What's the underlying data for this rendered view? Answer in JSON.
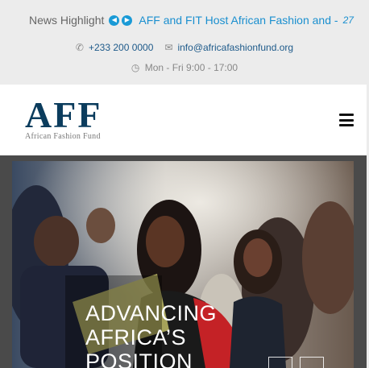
{
  "news": {
    "label": "News Highlight",
    "prev_icon": "chevron-left-circle-icon",
    "next_icon": "chevron-right-circle-icon",
    "headline": "AFF and FIT Host African Fashion and -",
    "date": "27"
  },
  "contact": {
    "phone": "+233 200 0000",
    "email": "info@africafashionfund.org",
    "hours": "Mon - Fri 9:00 - 17:00"
  },
  "header": {
    "logo_main": "AFF",
    "logo_sub": "African Fashion Fund",
    "menu_icon": "hamburger-menu-icon"
  },
  "hero": {
    "title_line1": "ADVANCING",
    "title_line2": "AFRICA’S",
    "title_line3": "POSITION"
  },
  "colors": {
    "accent": "#1a9ad6",
    "brand": "#0b3c5d",
    "topbar_bg": "#ececec"
  }
}
